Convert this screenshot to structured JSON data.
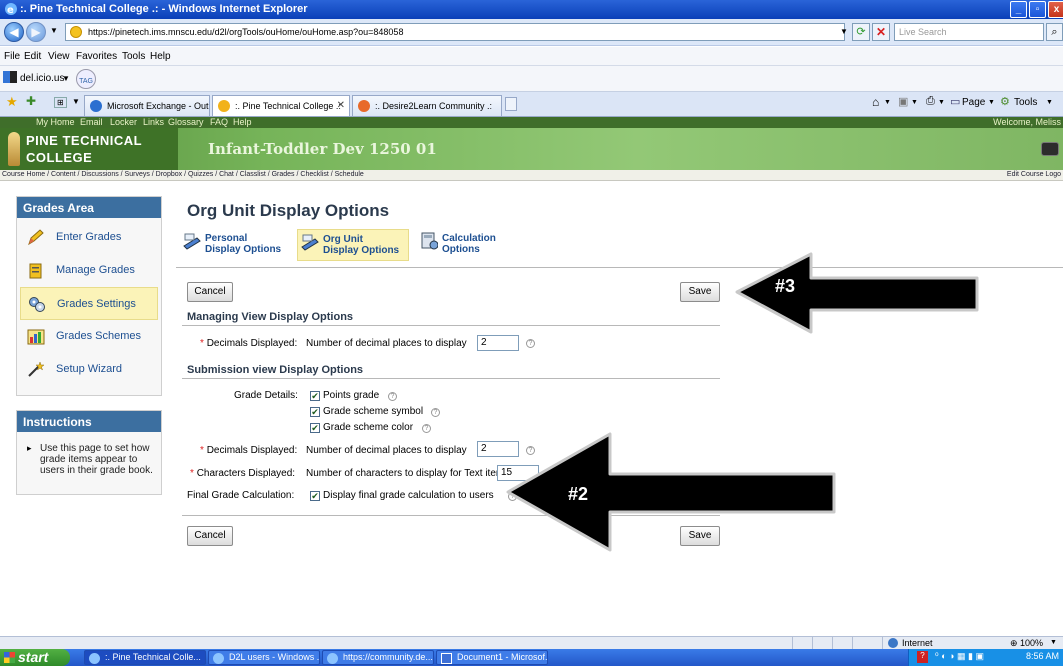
{
  "window": {
    "title": ":. Pine Technical College .: - Windows Internet Explorer"
  },
  "addressbar": {
    "url": "https://pinetech.ims.mnscu.edu/d2l/orgTools/ouHome/ouHome.asp?ou=848058",
    "search_placeholder": "Live Search"
  },
  "menubar": [
    "File",
    "Edit",
    "View",
    "Favorites",
    "Tools",
    "Help"
  ],
  "linksbar": {
    "delicious": "del.icio.us",
    "tag": "TAG"
  },
  "tabs": [
    {
      "label": "Microsoft Exchange - Outloo...",
      "active": false
    },
    {
      "label": ":. Pine Technical College .:",
      "active": true
    },
    {
      "label": ":. Desire2Learn Community .:",
      "active": false
    }
  ],
  "toolbar_right": {
    "page": "Page",
    "tools": "Tools"
  },
  "d2l": {
    "topnav": [
      "My Home",
      "Email",
      "Locker",
      "Links",
      "Glossary",
      "FAQ",
      "Help"
    ],
    "welcome": "Welcome, Meliss",
    "logo_line1": "PINE TECHNICAL",
    "logo_line2": "COLLEGE",
    "course_title": "Infant-Toddler Dev 1250 01",
    "course_nav": "Course Home / Content / Discussions / Surveys / Dropbox / Quizzes / Chat / Classlist / Grades / Checklist / Schedule",
    "course_nav_right": "Edit Course  Logo"
  },
  "sidebar": {
    "title": "Grades Area",
    "items": [
      {
        "label": "Enter Grades",
        "icon": "pencil-icon"
      },
      {
        "label": "Manage Grades",
        "icon": "gradebook-icon"
      },
      {
        "label": "Grades Settings",
        "icon": "settings-gears-icon",
        "selected": true
      },
      {
        "label": "Grades Schemes",
        "icon": "scheme-chart-icon"
      },
      {
        "label": "Setup Wizard",
        "icon": "wizard-wand-icon"
      }
    ],
    "instructions_title": "Instructions",
    "instructions_text": "Use this page to set how grade items appear to users in their grade book."
  },
  "main": {
    "title": "Org Unit Display Options",
    "subtabs": [
      {
        "line1": "Personal",
        "line2": "Display Options"
      },
      {
        "line1": "Org Unit",
        "line2": "Display Options"
      },
      {
        "line1": "Calculation",
        "line2": "Options"
      }
    ],
    "cancel": "Cancel",
    "save": "Save",
    "managing_heading": "Managing View Display Options",
    "decimals_label": "Decimals Displayed:",
    "decimals_desc": "Number of decimal places to display",
    "decimals_value": "2",
    "submission_heading": "Submission view Display Options",
    "grade_details_label": "Grade Details:",
    "grade_details": [
      {
        "label": "Points grade",
        "checked": true
      },
      {
        "label": "Grade scheme symbol",
        "checked": true
      },
      {
        "label": "Grade scheme color",
        "checked": true
      }
    ],
    "sub_decimals_label": "Decimals Displayed:",
    "sub_decimals_desc": "Number of decimal places to display",
    "sub_decimals_value": "2",
    "chars_label": "Characters Displayed:",
    "chars_desc": "Number of characters to display for Text items",
    "chars_value": "15",
    "final_label": "Final Grade Calculation:",
    "final_desc": "Display final grade calculation to users",
    "final_checked": true,
    "required_mark": "*",
    "help_mark": "?"
  },
  "annotations": {
    "arrow3": "#3",
    "arrow2": "#2"
  },
  "statusbar": {
    "zone": "Internet",
    "zoom": "100%"
  },
  "taskbar": {
    "start": "start",
    "items": [
      ":. Pine Technical Colle...",
      "D2L users - Windows ...",
      "https://community.de...",
      "Document1 - Microsof..."
    ],
    "clock": "8:56 AM"
  }
}
